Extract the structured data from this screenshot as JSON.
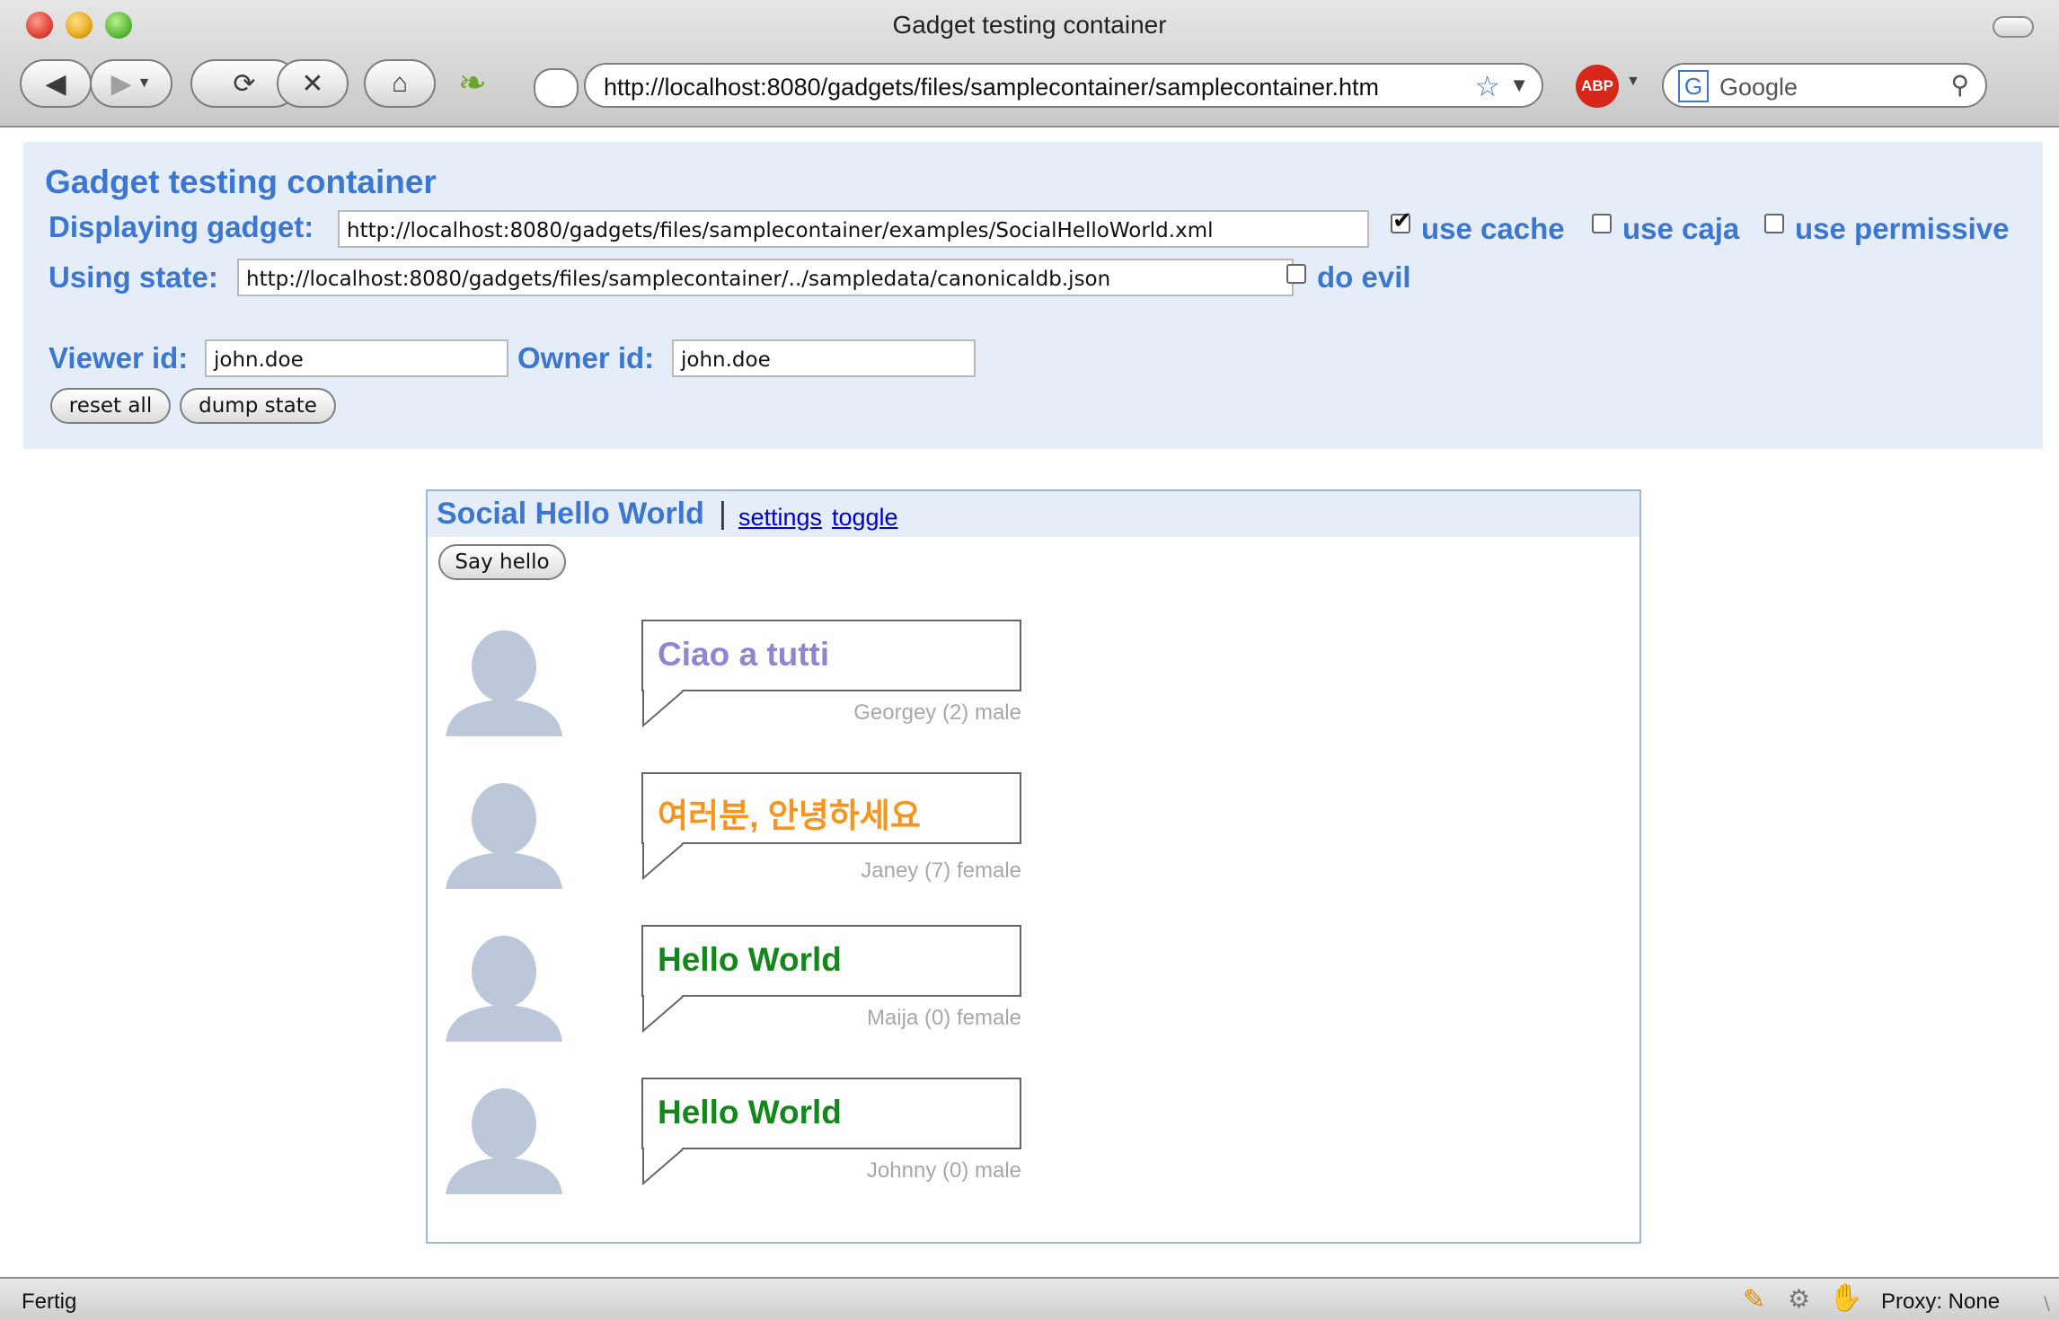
{
  "window": {
    "title": "Gadget testing container"
  },
  "browser": {
    "url": "http://localhost:8080/gadgets/files/samplecontainer/samplecontainer.htm",
    "search_engine_icon": "G",
    "search_placeholder": "Google",
    "adblock_label": "ABP"
  },
  "container": {
    "title": "Gadget testing container",
    "displaying_label": "Displaying gadget:",
    "gadget_url": "http://localhost:8080/gadgets/files/samplecontainer/examples/SocialHelloWorld.xml",
    "use_cache_label": "use cache",
    "use_cache_checked": true,
    "use_caja_label": "use caja",
    "use_caja_checked": false,
    "use_permissive_label": "use permissive",
    "use_permissive_checked": false,
    "using_state_label": "Using state:",
    "state_url": "http://localhost:8080/gadgets/files/samplecontainer/../sampledata/canonicaldb.json",
    "do_evil_label": "do evil",
    "do_evil_checked": false,
    "viewer_label": "Viewer id:",
    "viewer_id": "john.doe",
    "owner_label": "Owner id:",
    "owner_id": "john.doe",
    "reset_all": "reset all",
    "dump_state": "dump state"
  },
  "gadget": {
    "title": "Social Hello World",
    "separator": "|",
    "settings_link": "settings",
    "toggle_link": "toggle",
    "say_hello": "Say hello",
    "greetings": [
      {
        "message": "Ciao a tutti",
        "color": "#8e86cf",
        "person": "Georgey (2) male"
      },
      {
        "message": "여러분, 안녕하세요",
        "color": "#f7941d",
        "person": "Janey (7) female"
      },
      {
        "message": "Hello World",
        "color": "#12881a",
        "person": "Maija (0) female"
      },
      {
        "message": "Hello World",
        "color": "#12881a",
        "person": "Johnny (0) male"
      }
    ]
  },
  "status": {
    "text": "Fertig",
    "proxy": "Proxy: None"
  },
  "colors": {
    "accent": "#3a76d2",
    "panel_bg": "#e5eef8",
    "avatar": "#bcc8da"
  }
}
